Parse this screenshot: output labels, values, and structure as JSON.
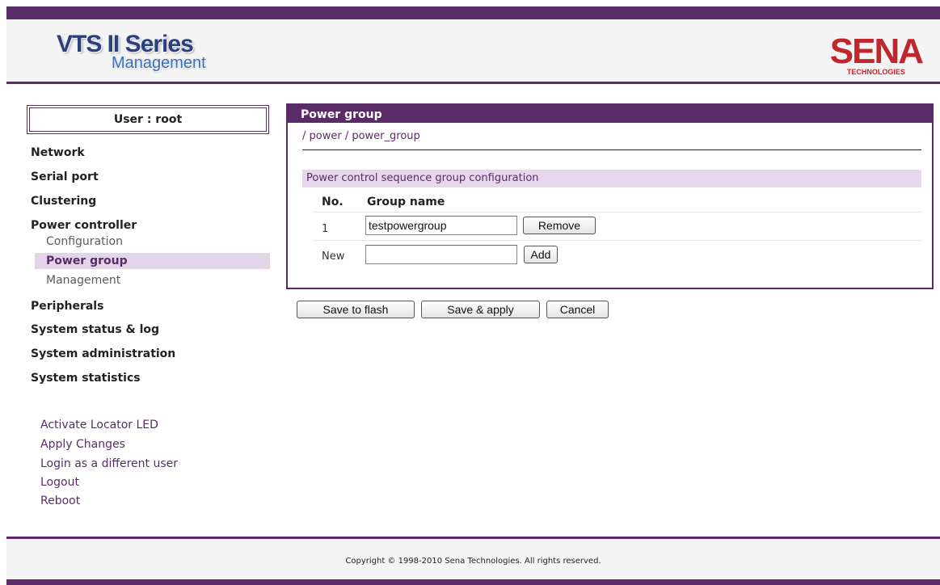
{
  "header": {
    "product_line1": "VTS II Series",
    "product_line2": "Management",
    "brand_line1": "SENA",
    "brand_line2": "TECHNOLOGIES"
  },
  "sidebar": {
    "user_label": "User : root",
    "nav": [
      {
        "label": "Network"
      },
      {
        "label": "Serial port"
      },
      {
        "label": "Clustering"
      },
      {
        "label": "Power controller"
      },
      {
        "label": "Peripherals"
      },
      {
        "label": "System status & log"
      },
      {
        "label": "System administration"
      },
      {
        "label": "System statistics"
      }
    ],
    "power_sub": [
      {
        "label": "Configuration"
      },
      {
        "label": "Power group",
        "active": true
      },
      {
        "label": "Management"
      }
    ],
    "links": [
      "Activate Locator LED",
      "Apply Changes",
      "Login as a different user",
      "Logout",
      "Reboot"
    ]
  },
  "main": {
    "title": "Power group",
    "breadcrumb": "/ power / power_group",
    "section_title": "Power control sequence group configuration",
    "columns": [
      "No.",
      "Group name"
    ],
    "rows": [
      {
        "no": "1",
        "name": "testpowergroup",
        "action": "Remove"
      }
    ],
    "new_row": {
      "label": "New",
      "value": "",
      "action": "Add"
    },
    "buttons": {
      "save_flash": "Save to flash",
      "save_apply": "Save & apply",
      "cancel": "Cancel"
    }
  },
  "footer": {
    "copyright": "Copyright © 1998-2010 Sena Technologies. All rights reserved."
  },
  "colors": {
    "accent": "#5a2c67",
    "highlight": "#e3d4e8",
    "brand_red": "#c0262d"
  }
}
